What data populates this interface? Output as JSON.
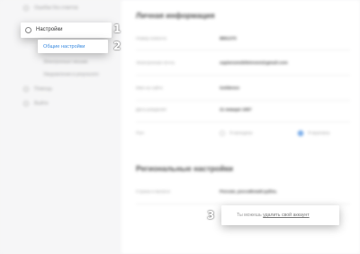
{
  "sidebar": {
    "top_item": "Ошибки без ответов",
    "settings_label": "Настройки",
    "sub_general": "Общие настройки",
    "sub_notifications": "Электронные письма",
    "sub_access": "Уведомления в результате",
    "help": "Помощь",
    "logout": "Выйти"
  },
  "personal": {
    "title": "Личная информация",
    "rows": [
      {
        "label": "Номер клиента",
        "value": "8861370"
      },
      {
        "label": "Электронная почта",
        "value": "sapiensmobileinvest@gmail.com"
      },
      {
        "label": "Имя на сайте",
        "value": "Goldenov"
      },
      {
        "label": "Дата рождения",
        "value": "21 января 1957"
      }
    ],
    "gender_label": "Пол",
    "gender_female": "Я женщина",
    "gender_male": "Я мужчина"
  },
  "regional": {
    "title": "Региональные настройки",
    "country_label": "Страна и валюта",
    "country_value": "Россия, российский рубль"
  },
  "delete_account": {
    "prefix": "Ты можешь ",
    "link": "удалить свой аккаунт"
  },
  "callout_numbers": {
    "one": "1",
    "two": "2",
    "three": "3"
  },
  "colors": {
    "accent": "#3b8be0",
    "radio_selected": "#4a90e2"
  }
}
